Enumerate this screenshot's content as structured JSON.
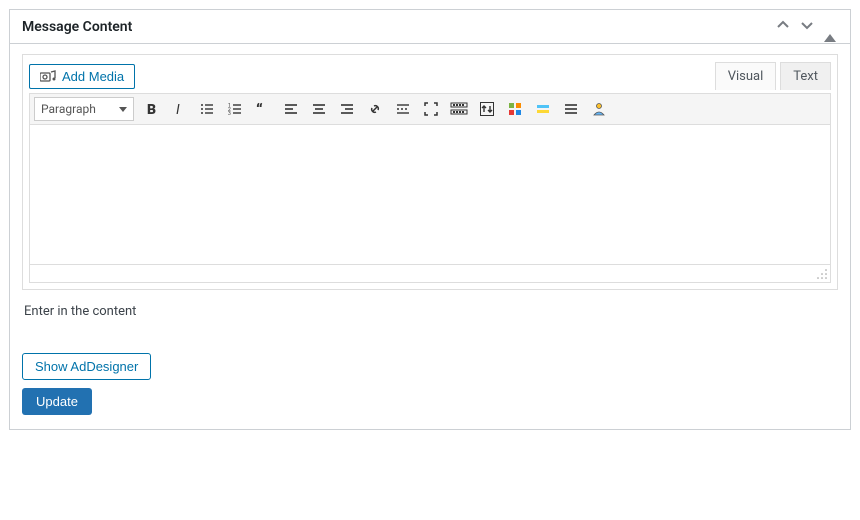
{
  "header": {
    "title": "Message Content"
  },
  "editor": {
    "add_media_label": "Add Media",
    "tabs": {
      "visual": "Visual",
      "text": "Text"
    },
    "format_select": "Paragraph"
  },
  "help_text": "Enter in the content",
  "buttons": {
    "show_addesigner": "Show AdDesigner",
    "update": "Update"
  }
}
